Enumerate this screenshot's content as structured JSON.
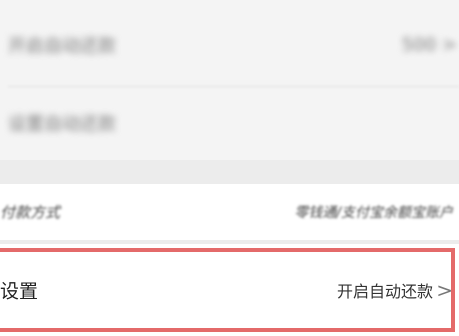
{
  "rows": {
    "r1": {
      "label": "开启自动还款",
      "value": "500 >"
    },
    "r2": {
      "label": "设置自动还款",
      "value": ""
    },
    "r3": {
      "label": "付款方式",
      "value": "零钱通/支付宝余额宝账户"
    },
    "r4": {
      "label": "设置",
      "value": "开启自动还款",
      "chevron": ">"
    }
  },
  "colors": {
    "highlight_border": "#e46a6a",
    "background": "#ececec"
  }
}
